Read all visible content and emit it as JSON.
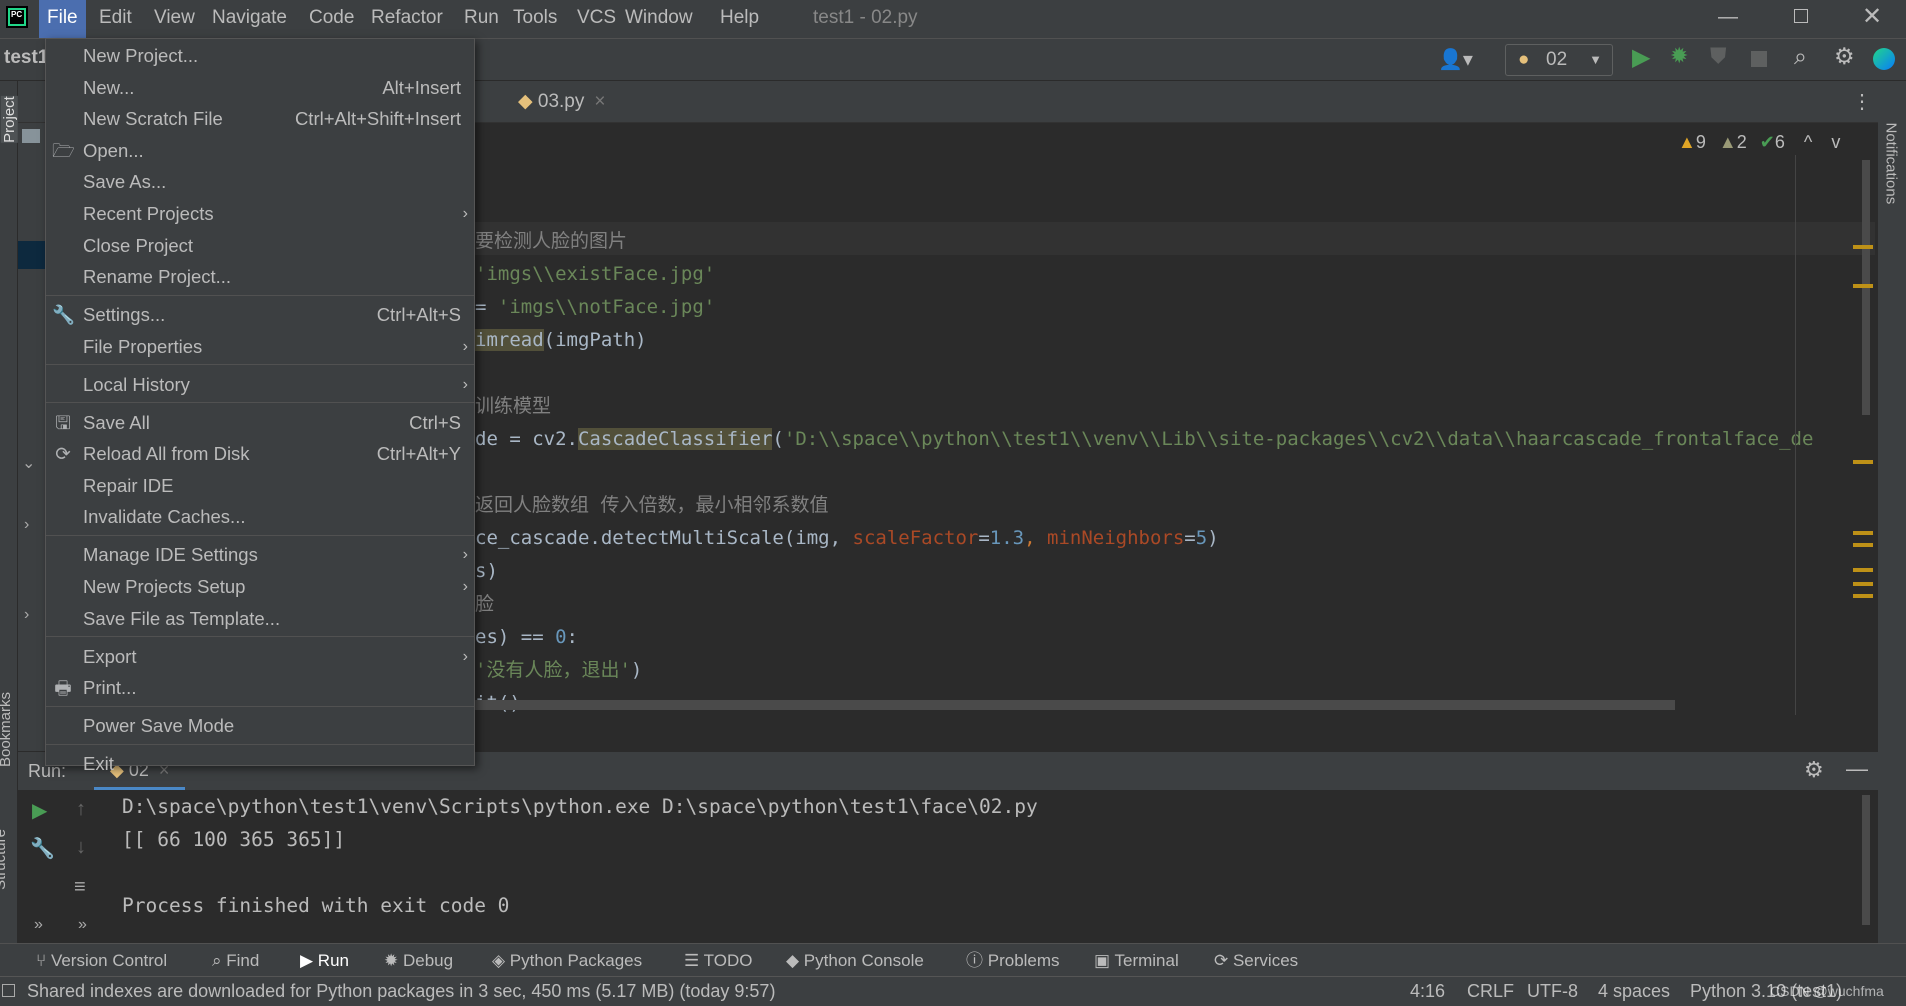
{
  "window": {
    "title": "test1 - 02.py",
    "project_label": "test1"
  },
  "menubar": [
    "File",
    "Edit",
    "View",
    "Navigate",
    "Code",
    "Refactor",
    "Run",
    "Tools",
    "VCS",
    "Window",
    "Help"
  ],
  "toolbar": {
    "run_config": "02"
  },
  "tabs": [
    {
      "label": "03.py"
    }
  ],
  "inspections": {
    "warnings": "9",
    "weak_warnings": "2",
    "typos": "6"
  },
  "file_menu": [
    {
      "label": "New Project...",
      "shortcut": ""
    },
    {
      "label": "New...",
      "shortcut": "Alt+Insert"
    },
    {
      "label": "New Scratch File",
      "shortcut": "Ctrl+Alt+Shift+Insert"
    },
    {
      "label": "Open...",
      "shortcut": "",
      "icon": "folder-icon"
    },
    {
      "label": "Save As...",
      "shortcut": ""
    },
    {
      "label": "Recent Projects",
      "shortcut": "",
      "submenu": true
    },
    {
      "label": "Close Project",
      "shortcut": ""
    },
    {
      "label": "Rename Project...",
      "shortcut": "",
      "sep_after": true
    },
    {
      "label": "Settings...",
      "shortcut": "Ctrl+Alt+S",
      "icon": "wrench-icon"
    },
    {
      "label": "File Properties",
      "shortcut": "",
      "submenu": true,
      "sep_after": true
    },
    {
      "label": "Local History",
      "shortcut": "",
      "submenu": true,
      "sep_after": true
    },
    {
      "label": "Save All",
      "shortcut": "Ctrl+S",
      "icon": "save-icon"
    },
    {
      "label": "Reload All from Disk",
      "shortcut": "Ctrl+Alt+Y",
      "icon": "reload-icon"
    },
    {
      "label": "Repair IDE",
      "shortcut": ""
    },
    {
      "label": "Invalidate Caches...",
      "shortcut": "",
      "sep_after": true
    },
    {
      "label": "Manage IDE Settings",
      "shortcut": "",
      "submenu": true
    },
    {
      "label": "New Projects Setup",
      "shortcut": "",
      "submenu": true
    },
    {
      "label": "Save File as Template...",
      "shortcut": "",
      "sep_after": true
    },
    {
      "label": "Export",
      "shortcut": "",
      "submenu": true
    },
    {
      "label": "Print...",
      "shortcut": "",
      "icon": "print-icon",
      "sep_after": true
    },
    {
      "label": "Power Save Mode",
      "shortcut": "",
      "sep_after": true
    },
    {
      "label": "Exit",
      "shortcut": ""
    }
  ],
  "code_lines": [
    [
      {
        "t": "要检测人脸的图片",
        "c": "#808080"
      }
    ],
    [
      {
        "t": "'imgs\\\\existFace.jpg'",
        "c": "#6a8759"
      }
    ],
    [
      {
        "t": "= ",
        "c": "#a9b7c6"
      },
      {
        "t": "'imgs\\\\notFace.jpg'",
        "c": "#6a8759"
      }
    ],
    [
      {
        "t": "imread",
        "c": "#a9b7c6",
        "bg": "#52503a"
      },
      {
        "t": "(imgPath)",
        "c": "#a9b7c6"
      }
    ],
    [],
    [
      {
        "t": "训练模型",
        "c": "#808080"
      }
    ],
    [
      {
        "t": "de = cv2.",
        "c": "#a9b7c6"
      },
      {
        "t": "CascadeClassifier",
        "c": "#a9b7c6",
        "bg": "#52503a"
      },
      {
        "t": "(",
        "c": "#a9b7c6"
      },
      {
        "t": "'D:\\\\space\\\\python\\\\test1\\\\venv\\\\Lib\\\\site-packages\\\\cv2\\\\data\\\\haarcascade_frontalface_de",
        "c": "#6a8759"
      }
    ],
    [],
    [
      {
        "t": "返回人脸数组 传入倍数，最小相邻系数值",
        "c": "#808080"
      }
    ],
    [
      {
        "t": "ce_cascade.detectMultiScale(img, ",
        "c": "#a9b7c6"
      },
      {
        "t": "scaleFactor",
        "c": "#aa4926"
      },
      {
        "t": "=",
        "c": "#a9b7c6"
      },
      {
        "t": "1.3",
        "c": "#6897bb"
      },
      {
        "t": ", ",
        "c": "#cc7832"
      },
      {
        "t": "minNeighbors",
        "c": "#aa4926"
      },
      {
        "t": "=",
        "c": "#a9b7c6"
      },
      {
        "t": "5",
        "c": "#6897bb"
      },
      {
        "t": ")",
        "c": "#a9b7c6"
      }
    ],
    [
      {
        "t": "s)",
        "c": "#a9b7c6"
      }
    ],
    [
      {
        "t": "脸",
        "c": "#808080"
      }
    ],
    [
      {
        "t": "es) == ",
        "c": "#a9b7c6"
      },
      {
        "t": "0",
        "c": "#6897bb"
      },
      {
        "t": ":",
        "c": "#a9b7c6"
      }
    ],
    [
      {
        "t": "'没有人脸，退出'",
        "c": "#6a8759"
      },
      {
        "t": ")",
        "c": "#a9b7c6"
      }
    ],
    [
      {
        "t": "it()",
        "c": "#a9b7c6"
      }
    ]
  ],
  "run": {
    "label": "Run:",
    "tab": "02",
    "output": [
      "D:\\space\\python\\test1\\venv\\Scripts\\python.exe D:\\space\\python\\test1\\face\\02.py",
      "[[ 66 100 365 365]]",
      "",
      "Process finished with exit code 0"
    ]
  },
  "bottom_tabs": [
    "Version Control",
    "Find",
    "Run",
    "Debug",
    "Python Packages",
    "TODO",
    "Python Console",
    "Problems",
    "Terminal",
    "Services"
  ],
  "side_labels": {
    "project": "Project",
    "bookmarks": "Bookmarks",
    "structure": "Structure",
    "notifications": "Notifications"
  },
  "status": {
    "message": "Shared indexes are downloaded for Python packages in 3 sec, 450 ms (5.17 MB) (today 9:57)",
    "position": "4:16",
    "line_sep": "CRLF",
    "encoding": "UTF-8",
    "indent": "4 spaces",
    "interpreter": "Python 3.10 (test1)",
    "watermark": "CSDN @wuchfma"
  },
  "colors": {
    "menu_active": "#4b6eaf",
    "run_green": "#499c54",
    "warning": "#e0a526"
  }
}
